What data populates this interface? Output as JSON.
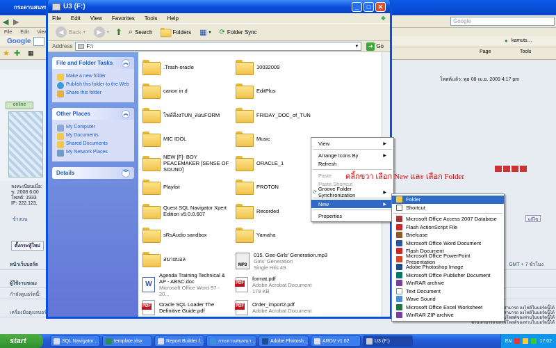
{
  "ie": {
    "title": "กระดานสนทนา",
    "menu": [
      "File",
      "Edit",
      "View"
    ],
    "google_label": "Google",
    "google_search_placeholder": "Google",
    "user": "kamuts…",
    "page_menu": "Page",
    "tools_menu": "Tools",
    "forum": {
      "posted": "โพสต์แล้ว: พุธ 08 เม.ย. 2009 4:17 pm",
      "online": "online",
      "status_lines": [
        "ลงทะเบียนเมื่อ:",
        "ข. 2008 6:00",
        "โพสต์: 1933",
        "IP: 222.123."
      ],
      "back_to_top": "ข้างบน",
      "new_topic": "ตั้งกระทู้ใหม่",
      "row1": "หน้าเว็บบอร์ด",
      "row1_right": "GMT + 7 ชั่วโมง",
      "row2": "ผู้ใช้งานขณะ",
      "row3": "กำลังดูบอร์ดนี้:",
      "row4": "เครื่องมือดูแลบอร์ด",
      "row_right_a": "ท่าน สามารถ ลงไฟล์ในบอร์ดนี้ได้",
      "row_right_b": "ท่าน สามารถ ลงไฟล์ในบอร์ดนี้ได้",
      "row_right_c": "ท่าน สามารถ ลบโพสต์ของท่านในบอร์ดนี้ได้",
      "row_right_d": "ท่าน สามารถ แก้ไขโพสต์ของท่านในบอร์ดนี้ได้",
      "edit_btn": "แก้ไข"
    }
  },
  "explorer": {
    "title": "U3 (F:)",
    "menu": [
      "File",
      "Edit",
      "View",
      "Favorites",
      "Tools",
      "Help"
    ],
    "toolbar": {
      "back": "Back",
      "search": "Search",
      "folders": "Folders",
      "folder_sync": "Folder Sync"
    },
    "address_label": "Address",
    "address_value": "F:\\",
    "go": "Go",
    "tasks": {
      "file_folder_title": "File and Folder Tasks",
      "file_folder_items": [
        "Make a new folder",
        "Publish this folder to the Web",
        "Share this folder"
      ],
      "other_places_title": "Other Places",
      "other_places_items": [
        "My Computer",
        "My Documents",
        "Shared Documents",
        "My Network Places"
      ],
      "details_title": "Details"
    },
    "files": [
      {
        "name": ".Trash-oracle",
        "type": "folder"
      },
      {
        "name": "10032009",
        "type": "folder"
      },
      {
        "name": "canon in d",
        "type": "folder"
      },
      {
        "name": "EditPlus",
        "type": "folder"
      },
      {
        "name": "ไฟล์สิ่งงTUN_สอบFORM",
        "type": "folder"
      },
      {
        "name": "FRIDAY_DOC_of_TUN",
        "type": "folder"
      },
      {
        "name": "MIC IDOL",
        "type": "folder"
      },
      {
        "name": "Music",
        "type": "folder"
      },
      {
        "name": "NEW [F]- BOY PEACEMAKER [SENSE OF SOUND]",
        "type": "folder"
      },
      {
        "name": "ORACLE_1",
        "type": "folder"
      },
      {
        "name": "Playlist",
        "type": "folder"
      },
      {
        "name": "PROTON",
        "type": "folder"
      },
      {
        "name": "Quest SQL Navigator Xpert Edition v5.0.0.607",
        "type": "folder"
      },
      {
        "name": "Recorded",
        "type": "folder"
      },
      {
        "name": "sRsAudio sandbox",
        "type": "folder"
      },
      {
        "name": "Yamaha",
        "type": "folder"
      },
      {
        "name": "สมายบอล",
        "type": "folder"
      },
      {
        "name": "015. Gee-Girls' Generation.mp3",
        "sub1": "Girls' Generation",
        "sub2": "Single Hits 49",
        "type": "mp3"
      },
      {
        "name": "Agenda Training Technical & AP - ABSC.doc",
        "sub1": "Microsoft Office Word 97 - 20...",
        "type": "doc"
      },
      {
        "name": "format.pdf",
        "sub1": "Adobe Acrobat Document",
        "sub2": "178 KB",
        "type": "pdf"
      },
      {
        "name": "Oracle SQL Loader The Definitive Guide.pdf",
        "type": "pdf"
      },
      {
        "name": "Order_import2.pdf",
        "sub1": "Adobe Acrobat Document",
        "type": "pdf"
      }
    ]
  },
  "context_menu": {
    "items": [
      {
        "label": "View",
        "submenu": true
      },
      {
        "sep": true
      },
      {
        "label": "Arrange Icons By",
        "submenu": true
      },
      {
        "label": "Refresh"
      },
      {
        "sep": true
      },
      {
        "label": "Paste",
        "disabled": true
      },
      {
        "label": "Paste Shortcut",
        "disabled": true
      },
      {
        "label": "Groove Folder Synchronization",
        "submenu": true
      },
      {
        "sep": true
      },
      {
        "label": "New",
        "submenu": true,
        "selected": true
      },
      {
        "sep": true
      },
      {
        "label": "Properties"
      }
    ]
  },
  "new_submenu": {
    "items": [
      {
        "label": "Folder",
        "icon": "folder-icon",
        "selected": true
      },
      {
        "label": "Shortcut",
        "icon": "shortcut-icon"
      },
      {
        "sep": true
      },
      {
        "label": "Microsoft Office Access 2007 Database",
        "icon": "access-icon"
      },
      {
        "label": "Flash ActionScript File",
        "icon": "flash-icon"
      },
      {
        "label": "Briefcase",
        "icon": "briefcase-icon"
      },
      {
        "label": "Microsoft Office Word Document",
        "icon": "word-icon"
      },
      {
        "label": "Flash Document",
        "icon": "flash-doc-icon"
      },
      {
        "label": "Microsoft Office PowerPoint Presentation",
        "icon": "powerpoint-icon"
      },
      {
        "label": "Adobe Photoshop Image",
        "icon": "photoshop-icon"
      },
      {
        "label": "Microsoft Office Publisher Document",
        "icon": "publisher-icon"
      },
      {
        "label": "WinRAR archive",
        "icon": "winrar-icon"
      },
      {
        "label": "Text Document",
        "icon": "text-icon"
      },
      {
        "label": "Wave Sound",
        "icon": "wave-icon"
      },
      {
        "label": "Microsoft Office Excel Worksheet",
        "icon": "excel-icon"
      },
      {
        "label": "WinRAR ZIP archive",
        "icon": "winrar-zip-icon"
      }
    ]
  },
  "annotation": "คลิ้กขวา เลือก New และ เลือก Folder",
  "taskbar": {
    "start": "start",
    "tasks": [
      {
        "label": "SQL Navigator ..."
      },
      {
        "label": "template.xlsx"
      },
      {
        "label": "Report Builder f..."
      },
      {
        "label": "กระดานสนทนา ..."
      },
      {
        "label": "Adobe Photosh..."
      },
      {
        "label": "ARDV v1.02"
      },
      {
        "label": "U3 (F:)",
        "active": true
      }
    ],
    "lang": "EN",
    "clock": "17:02"
  },
  "colors": {
    "xp_blue": "#0a50d8",
    "task_pane": "#6f8ce0",
    "selection": "#316ac5",
    "annotation": "#e00000",
    "start_green": "#3c9d37"
  }
}
